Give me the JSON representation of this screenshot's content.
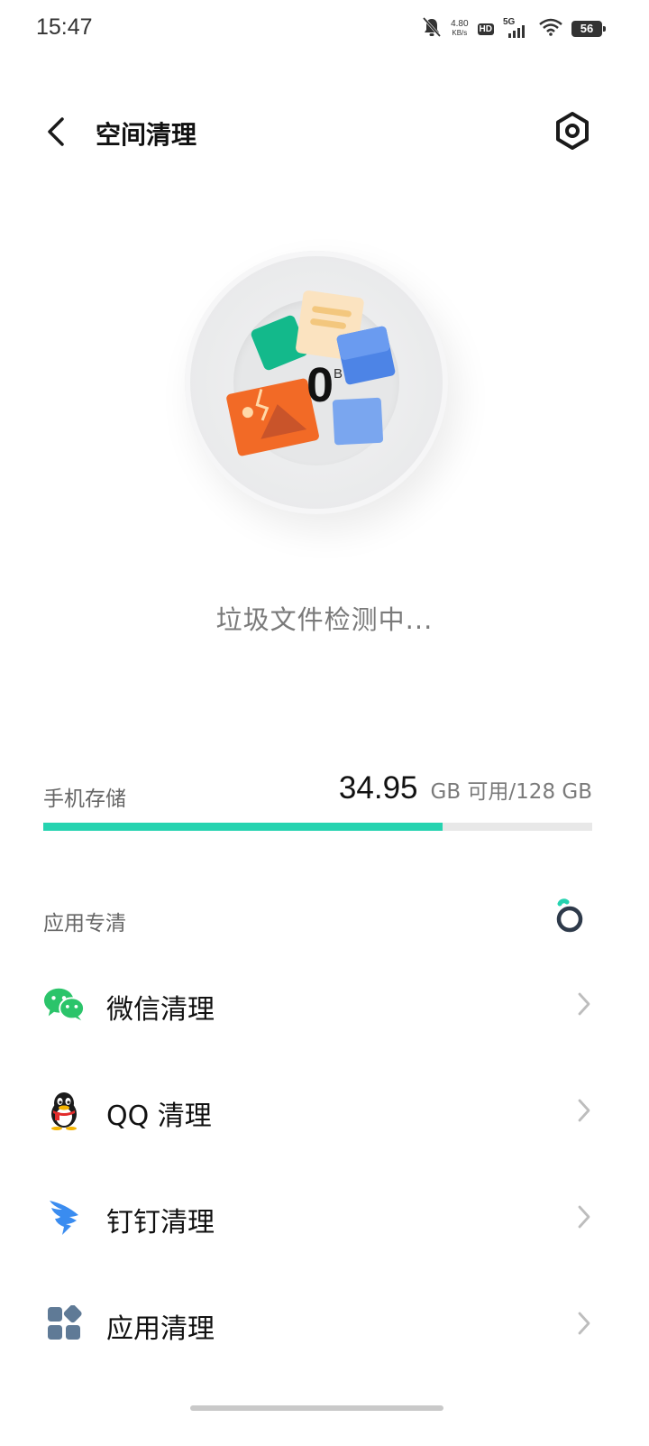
{
  "status_bar": {
    "time": "15:47",
    "net_speed_value": "4.80",
    "net_speed_unit": "KB/s",
    "hd_badge": "HD",
    "network_type": "5G",
    "battery_level": "56"
  },
  "header": {
    "title": "空间清理"
  },
  "scan": {
    "count_value": "0",
    "count_unit": "B",
    "status_text": "垃圾文件检测中..."
  },
  "storage": {
    "label": "手机存储",
    "available": "34.95",
    "suffix": "GB 可用/128 GB",
    "used_fraction": 0.727
  },
  "app_clean": {
    "section_title": "应用专清",
    "items": [
      {
        "label": "微信清理",
        "icon": "wechat-icon"
      },
      {
        "label": "QQ 清理",
        "icon": "qq-icon"
      },
      {
        "label": "钉钉清理",
        "icon": "dingtalk-icon"
      },
      {
        "label": "应用清理",
        "icon": "apps-icon"
      }
    ]
  },
  "colors": {
    "accent": "#26d3b0",
    "wechat": "#2bc46a",
    "dingtalk": "#3a8cf0",
    "apps": "#5f7a96"
  }
}
